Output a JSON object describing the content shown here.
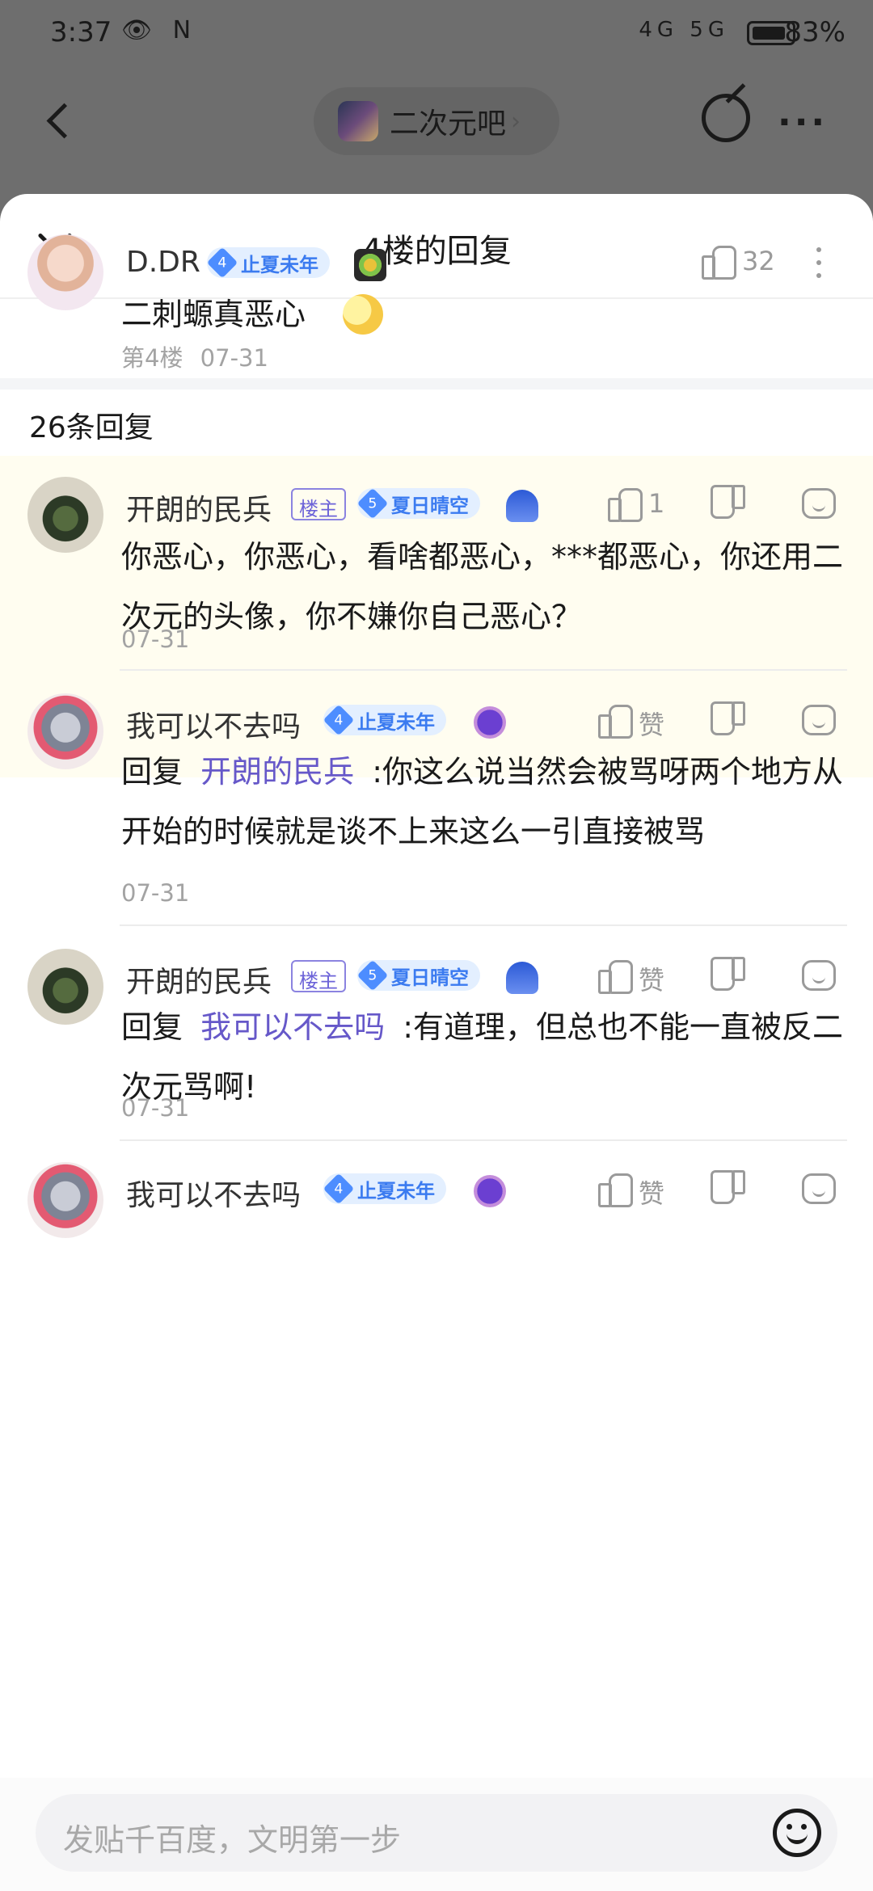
{
  "status_bar": {
    "time": "3:37",
    "left_icons": "👁 N",
    "network": "4G 5G",
    "battery": "83%"
  },
  "nav": {
    "forum_name": "二次元吧",
    "chevron": "›",
    "more": "···"
  },
  "sheet": {
    "title": "4楼的回复"
  },
  "main_post": {
    "username": "D.DR",
    "level": "4",
    "level_name": "止夏未年",
    "likes": "32",
    "text": "二刺螈真恶心",
    "floor": "第4楼",
    "date": "07-31"
  },
  "reply_count_label": "26条回复",
  "replies": [
    {
      "username": "开朗的民兵",
      "owner_badge": "楼主",
      "level": "5",
      "level_name": "夏日晴空",
      "likes": "1",
      "text": "你恶心，你恶心，看啥都恶心，***都恶心，你还用二次元的头像，你不嫌你自己恶心？",
      "date": "07-31"
    },
    {
      "username": "我可以不去吗",
      "level": "4",
      "level_name": "止夏未年",
      "likes": "赞",
      "reply_prefix": "回复",
      "reply_to": "开朗的民兵",
      "text": ":你这么说当然会被骂呀两个地方从开始的时候就是谈不上来这么一引直接被骂",
      "date": "07-31"
    },
    {
      "username": "开朗的民兵",
      "owner_badge": "楼主",
      "level": "5",
      "level_name": "夏日晴空",
      "likes": "赞",
      "reply_prefix": "回复",
      "reply_to": "我可以不去吗",
      "text": ":有道理，但总也不能一直被反二次元骂啊!",
      "date": "07-31"
    },
    {
      "username": "我可以不去吗",
      "level": "4",
      "level_name": "止夏未年",
      "likes": "赞"
    }
  ],
  "input": {
    "placeholder": "发贴千百度，文明第一步"
  },
  "colors": {
    "link": "#6658c9",
    "level_badge": "#4d8dff",
    "highlight_bg": "#fffdf0"
  }
}
